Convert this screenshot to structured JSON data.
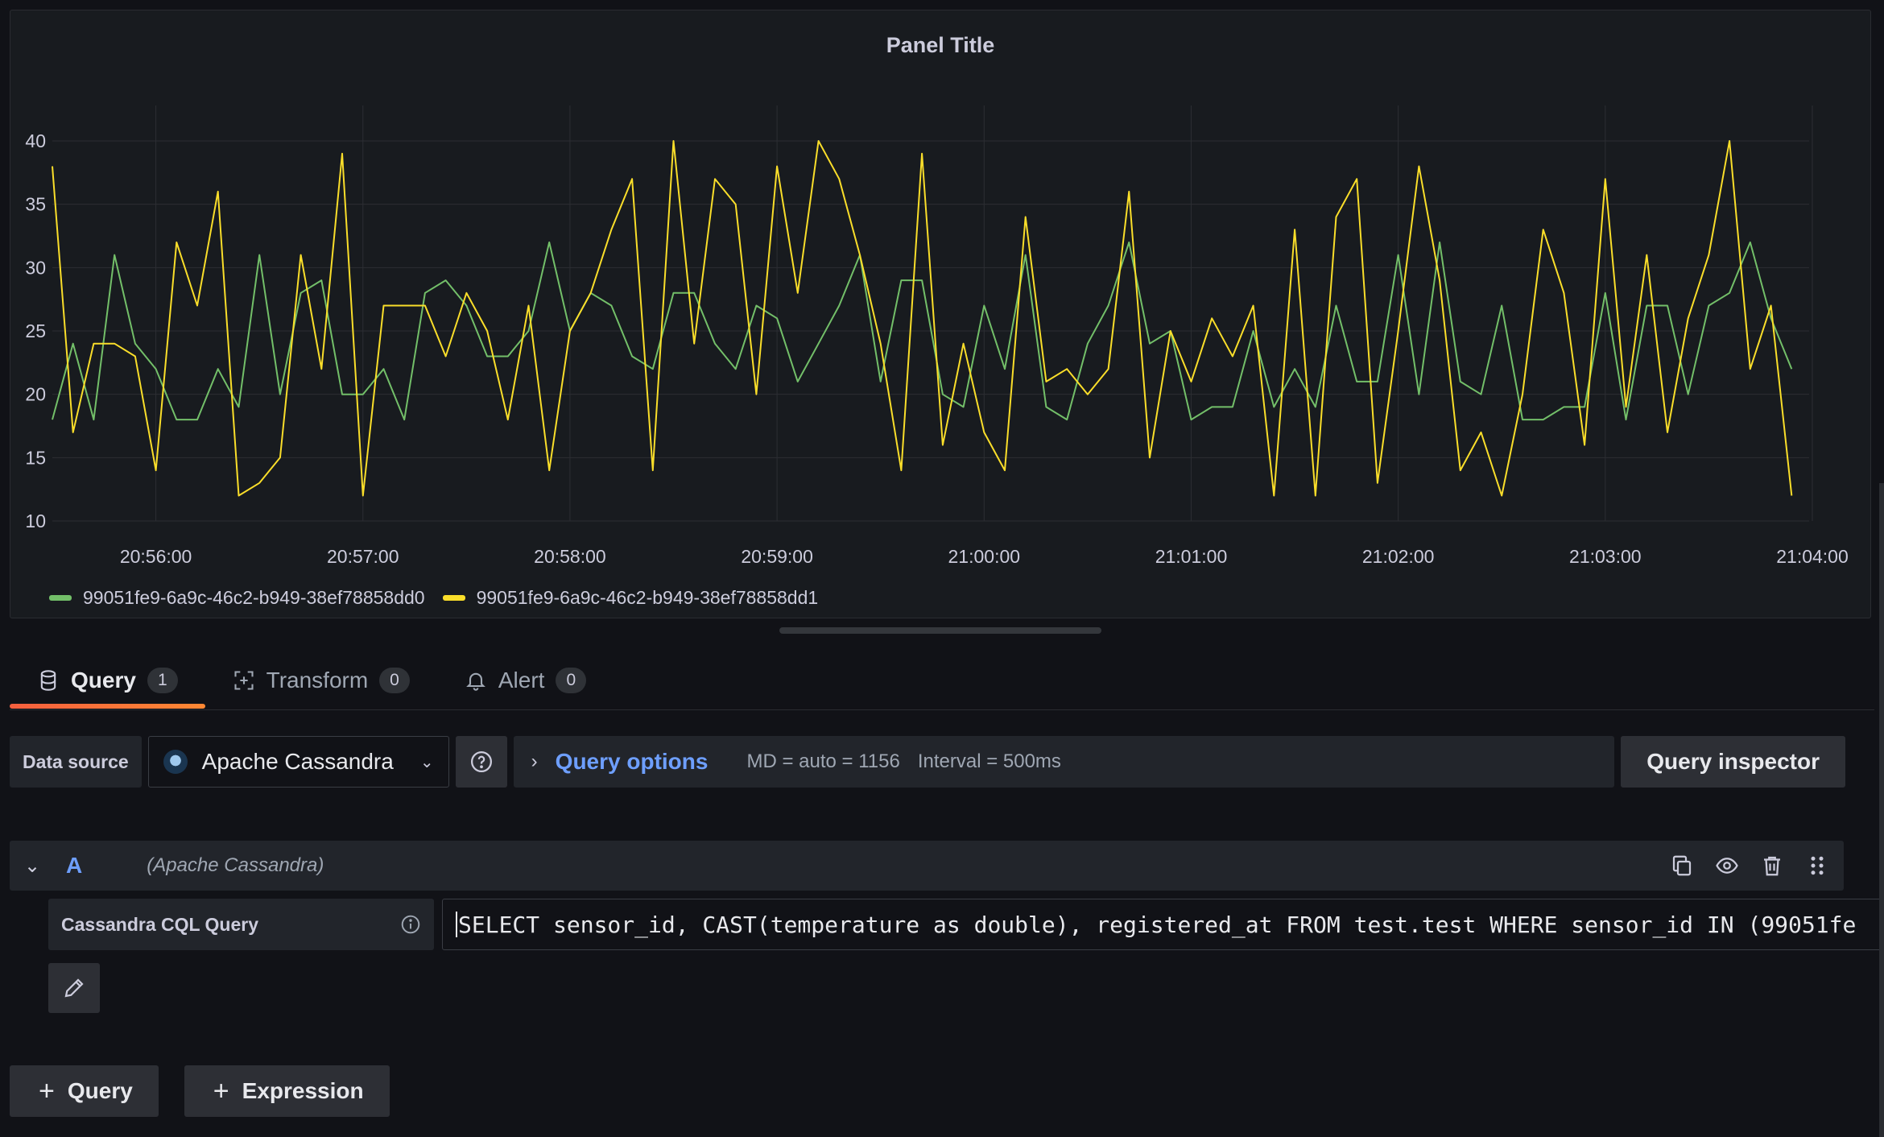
{
  "panel": {
    "title": "Panel Title"
  },
  "chart_data": {
    "type": "line",
    "title": "Panel Title",
    "ylim": [
      10,
      40
    ],
    "yticks": [
      10,
      15,
      20,
      25,
      30,
      35,
      40
    ],
    "xticks": [
      "20:56:00",
      "20:57:00",
      "20:58:00",
      "20:59:00",
      "21:00:00",
      "21:01:00",
      "21:02:00",
      "21:03:00",
      "21:04:00"
    ],
    "x_start": "20:55:30",
    "x_end": "21:04:00",
    "x_step_seconds": 6,
    "grid": true,
    "legend_position": "bottom-left",
    "series": [
      {
        "name": "99051fe9-6a9c-46c2-b949-38ef78858dd0",
        "color": "#73bf69",
        "values": [
          18,
          24,
          18,
          31,
          24,
          22,
          18,
          18,
          22,
          19,
          31,
          20,
          28,
          29,
          20,
          20,
          22,
          18,
          28,
          29,
          27,
          23,
          23,
          25,
          32,
          25,
          28,
          27,
          23,
          22,
          28,
          28,
          24,
          22,
          27,
          26,
          21,
          24,
          27,
          31,
          21,
          29,
          29,
          20,
          19,
          27,
          22,
          31,
          19,
          18,
          24,
          27,
          32,
          24,
          25,
          18,
          19,
          19,
          25,
          19,
          22,
          19,
          27,
          21,
          21,
          31,
          20,
          32,
          21,
          20,
          27,
          18,
          18,
          19,
          19,
          28,
          18,
          27,
          27,
          20,
          27,
          28,
          32,
          26,
          22
        ]
      },
      {
        "name": "99051fe9-6a9c-46c2-b949-38ef78858dd1",
        "color": "#fade2a",
        "values": [
          38,
          17,
          24,
          24,
          23,
          14,
          32,
          27,
          36,
          12,
          13,
          15,
          31,
          22,
          39,
          12,
          27,
          27,
          27,
          23,
          28,
          25,
          18,
          27,
          14,
          25,
          28,
          33,
          37,
          14,
          40,
          24,
          37,
          35,
          20,
          38,
          28,
          40,
          37,
          31,
          24,
          14,
          39,
          16,
          24,
          17,
          14,
          34,
          21,
          22,
          20,
          22,
          36,
          15,
          25,
          21,
          26,
          23,
          27,
          12,
          33,
          12,
          34,
          37,
          13,
          25,
          38,
          29,
          14,
          17,
          12,
          20,
          33,
          28,
          16,
          37,
          19,
          31,
          17,
          26,
          31,
          40,
          22,
          27,
          12
        ]
      }
    ]
  },
  "tabs": [
    {
      "label": "Query",
      "count": "1"
    },
    {
      "label": "Transform",
      "count": "0"
    },
    {
      "label": "Alert",
      "count": "0"
    }
  ],
  "datasource": {
    "label": "Data source",
    "selected": "Apache Cassandra"
  },
  "query_options": {
    "title": "Query options",
    "md": "MD = auto = 1156",
    "interval": "Interval = 500ms",
    "inspector_label": "Query inspector"
  },
  "query": {
    "ref_id": "A",
    "datasource_name": "(Apache Cassandra)",
    "field_label": "Cassandra CQL Query",
    "cql": "SELECT sensor_id, CAST(temperature as double), registered_at FROM test.test WHERE sensor_id IN (99051fe"
  },
  "actions": {
    "add_query": "Query",
    "add_expression": "Expression"
  }
}
